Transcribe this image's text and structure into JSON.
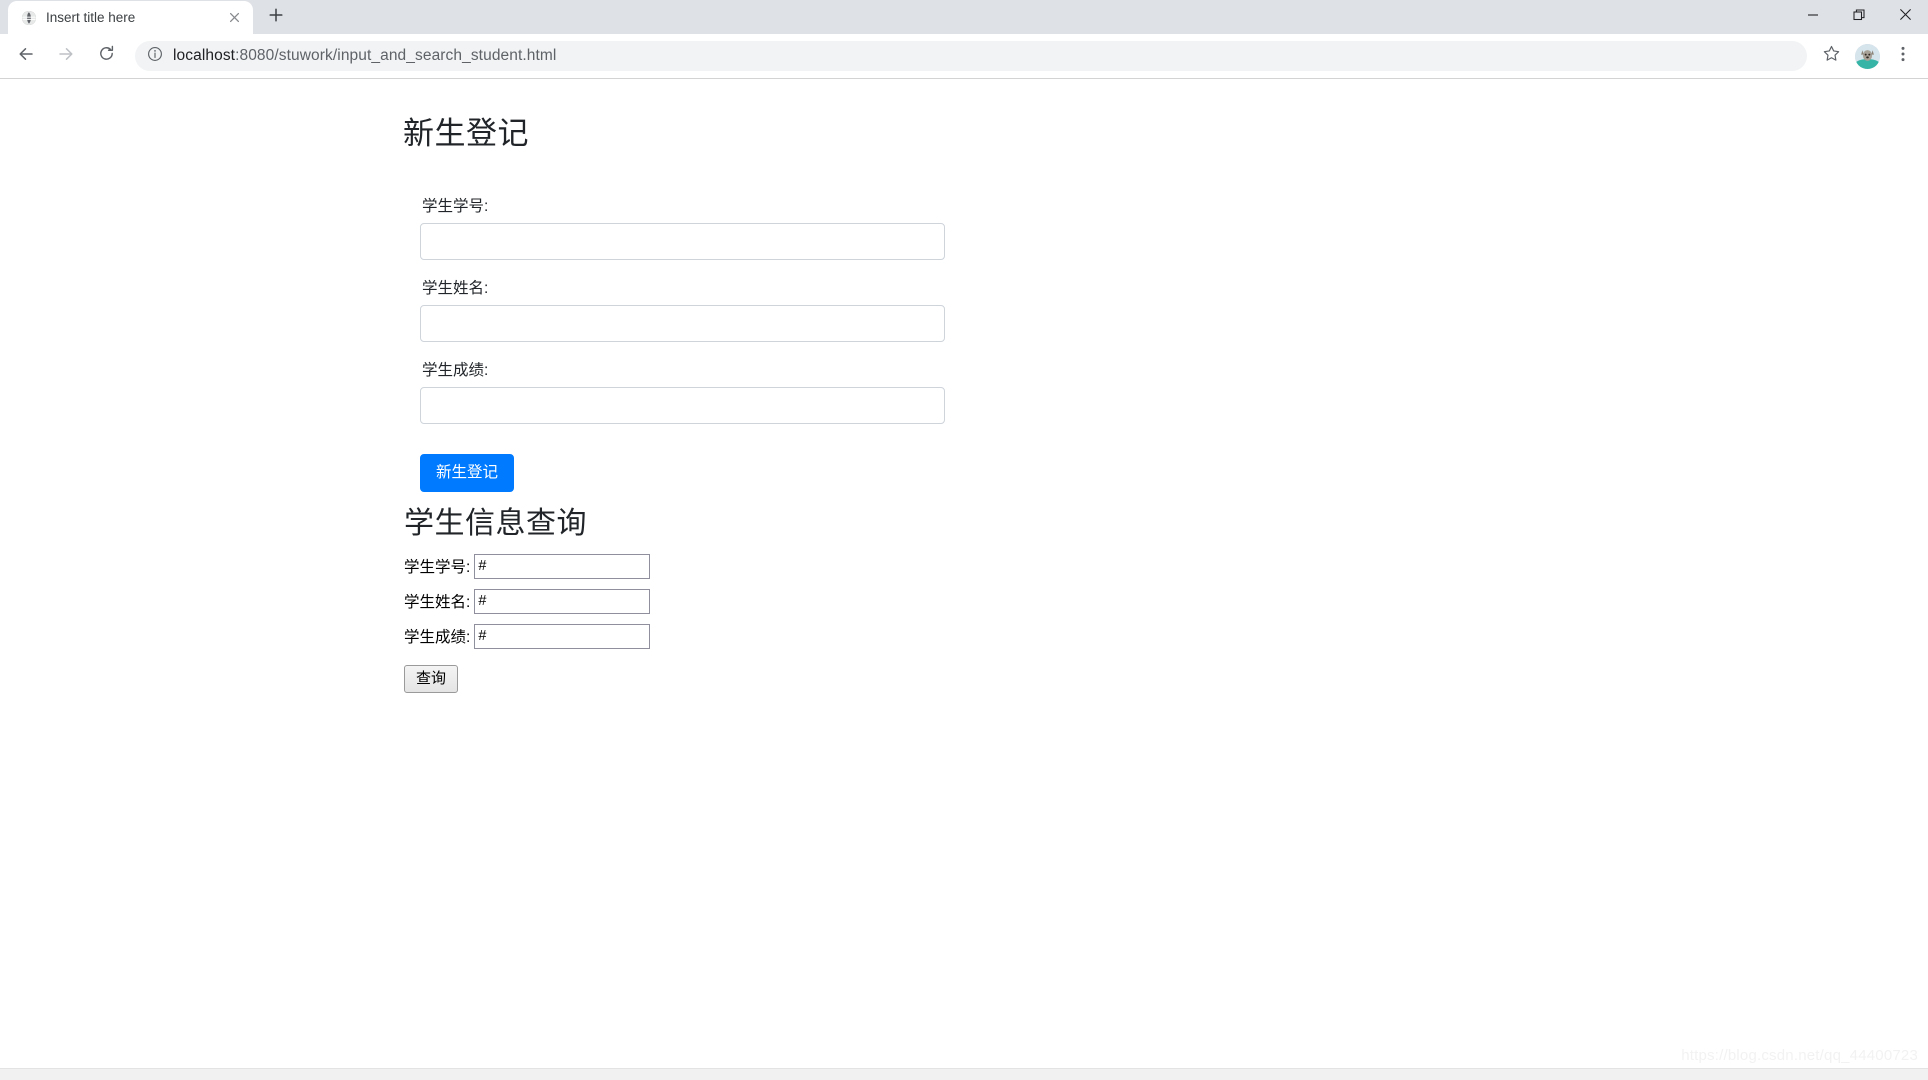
{
  "browser": {
    "tab": {
      "title": "Insert title here",
      "favicon_icon": "globe-icon",
      "close_icon": "close-icon"
    },
    "new_tab_icon": "plus-icon",
    "window_controls": {
      "minimize_icon": "minimize-icon",
      "maximize_icon": "restore-icon",
      "close_icon": "close-icon"
    },
    "nav": {
      "back_icon": "arrow-left-icon",
      "forward_icon": "arrow-right-icon",
      "reload_icon": "reload-icon"
    },
    "omnibox": {
      "info_icon": "info-circle-icon",
      "host": "localhost",
      "path": ":8080/stuwork/input_and_search_student.html",
      "full_url": "localhost:8080/stuwork/input_and_search_student.html"
    },
    "toolbar_right": {
      "bookmark_icon": "star-icon",
      "profile_icon": "avatar-dog-icon",
      "menu_icon": "three-dots-vertical-icon"
    }
  },
  "page": {
    "registration": {
      "heading": "新生登记",
      "fields": [
        {
          "label": "学生学号:",
          "value": "",
          "placeholder": ""
        },
        {
          "label": "学生姓名:",
          "value": "",
          "placeholder": ""
        },
        {
          "label": "学生成绩:",
          "value": "",
          "placeholder": ""
        }
      ],
      "submit_label": "新生登记",
      "submit_color": "#007bff"
    },
    "query": {
      "heading": "学生信息查询",
      "fields": [
        {
          "label": "学生学号:",
          "value": "#"
        },
        {
          "label": "学生姓名:",
          "value": "#"
        },
        {
          "label": "学生成绩:",
          "value": "#"
        }
      ],
      "submit_label": "查询"
    },
    "watermark": "https://blog.csdn.net/qq_44400723"
  }
}
